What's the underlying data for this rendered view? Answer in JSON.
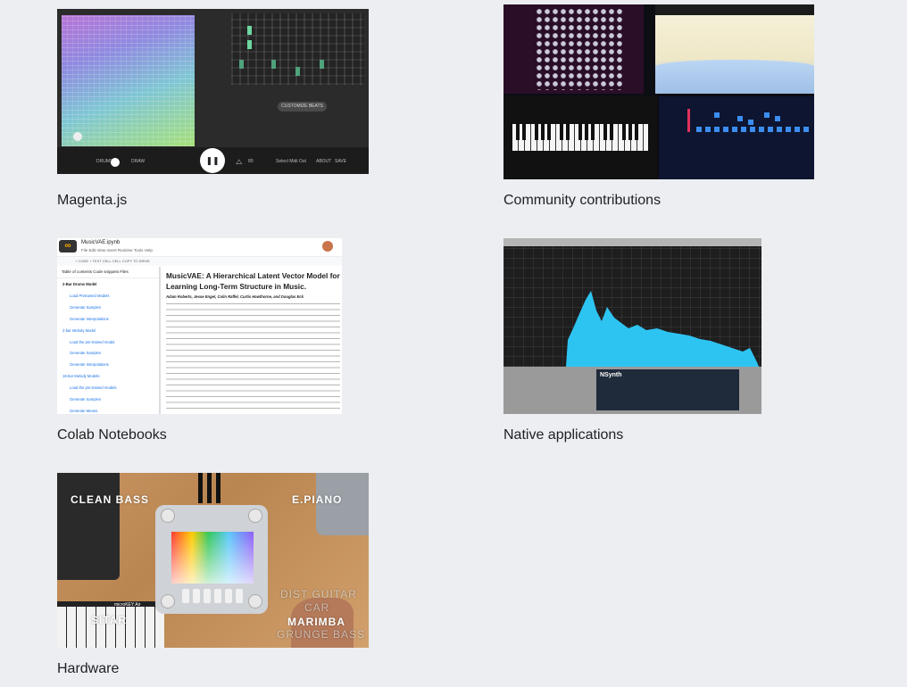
{
  "cards": [
    {
      "id": "magenta-js",
      "caption": "Magenta.js",
      "thumbnail": {
        "customize_label": "CUSTOMIZE BEATS",
        "bottom_labels": [
          "DRUMS",
          "DRUM",
          "DRAW",
          "Select Midi Out",
          "ABOUT",
          "SAVE"
        ],
        "play_icon": "pause-icon",
        "tempo_label": "80"
      }
    },
    {
      "id": "community-contributions",
      "caption": "Community contributions"
    },
    {
      "id": "colab-notebooks",
      "caption": "Colab Notebooks",
      "thumbnail": {
        "file_name": "MusicVAE.ipynb",
        "menu": "File  Edit  View  Insert  Runtime  Tools  Help",
        "toolbar": "+ CODE   + TEXT   CELL   CELL   COPY TO DRIVE",
        "sidebar_tabs": "Table of contents    Code snippets    Files",
        "toc": [
          "2-Bar Drums Model",
          "Load Pretrained Models",
          "Generate Samples",
          "Generate Interpolations",
          "2-bar Melody Model",
          "Load the pre-trained model.",
          "Generate Samples",
          "Generate Interpolations",
          "16-bar Melody Models",
          "Load the pre-trained models.",
          "Generate Samples",
          "Generate Means"
        ],
        "heading": "MusicVAE: A Hierarchical Latent Vector Model for Learning Long-Term Structure in Music.",
        "authors": "Adam Roberts, Jesse Engel, Colin Raffel, Curtis Hawthorne, and Douglas Eck"
      }
    },
    {
      "id": "native-applications",
      "caption": "Native applications",
      "thumbnail": {
        "plugin_name": "NSynth"
      }
    },
    {
      "id": "hardware",
      "caption": "Hardware",
      "thumbnail": {
        "labels": [
          "CLEAN BASS",
          "E.PIANO",
          "SITAR",
          "MARIMBA",
          "DIST GUITAR",
          "CAR",
          "GRUNGE BASS"
        ],
        "keyboard_label": "microKEY Air"
      }
    }
  ],
  "colors": {
    "background": "#eceef1",
    "caption": "#202124",
    "spectrum": "#2ec4f2"
  }
}
